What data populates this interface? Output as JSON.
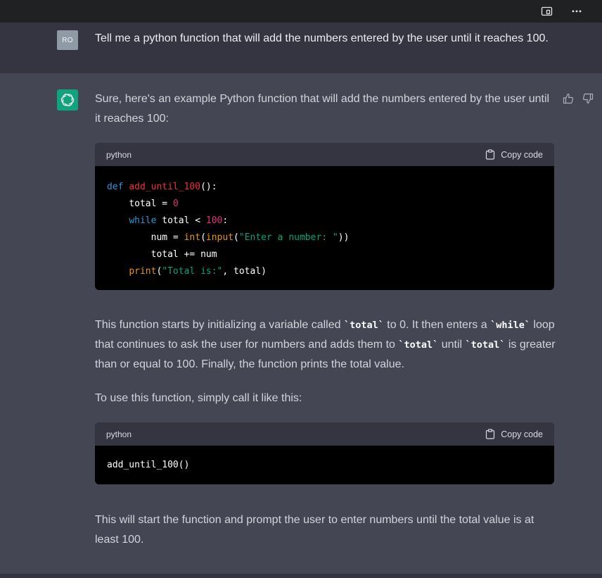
{
  "user_message": {
    "avatar": "RO",
    "text": "Tell me a python function that will add the numbers entered by the user until it reaches 100."
  },
  "assistant_message": {
    "intro": "Sure, here's an example Python function that will add the numbers entered by the user until it reaches 100:",
    "code_block_1": {
      "language": "python",
      "copy_label": "Copy code"
    },
    "explanation": {
      "p1": "This function starts by initializing a variable called ",
      "c1": "`total`",
      "p2": " to 0. It then enters a ",
      "c2": "`while`",
      "p3": " loop that continues to ask the user for numbers and adds them to ",
      "c3": "`total`",
      "p4": " until ",
      "c4": "`total`",
      "p5": " is greater than or equal to 100. Finally, the function prints the total value."
    },
    "usage_intro": "To use this function, simply call it like this:",
    "code_block_2": {
      "language": "python",
      "copy_label": "Copy code",
      "code": "add_until_100()"
    },
    "closing": "This will start the function and prompt the user to enter numbers until the total value is at least 100."
  },
  "code_tokens": {
    "def": "def",
    "fname": "add_until_100",
    "paren_colon": "():",
    "total": "total",
    "eq": " = ",
    "zero": "0",
    "while": "while",
    "lt": " total < ",
    "hundred": "100",
    "colon": ":",
    "num_eq": "num = ",
    "int": "int",
    "open": "(",
    "input": "input",
    "prompt_str": "\"Enter a number: \"",
    "close2": "))",
    "total_plus": "total += num",
    "print": "print",
    "total_str": "\"Total is:\"",
    "print_rest": ", total)"
  },
  "icons": {
    "topbar": [
      "sidebar-toggle-icon",
      "more-icon"
    ],
    "feedback": [
      "thumbs-up-icon",
      "thumbs-down-icon"
    ]
  },
  "colors": {
    "assistant_bg": "#444654",
    "user_bg": "#343541",
    "accent": "#10a37f"
  }
}
